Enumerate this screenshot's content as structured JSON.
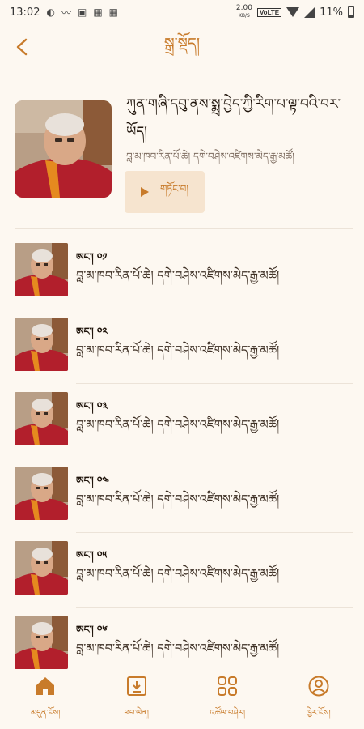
{
  "status_bar": {
    "time": "13:02",
    "net_speed": "2.00",
    "net_unit": "KB/S",
    "volte": "VoLTE",
    "battery": "11%"
  },
  "header": {
    "title": "སྒྲ་སྡོད།",
    "back_icon": "chevron-left-icon"
  },
  "featured": {
    "title": "ཀུན་གཞི་དབུ་ནས་སྨྲ་བྱེད་ཀྱི་རིག་པ་ལྟ་བའི་བར་ཡོད།",
    "speaker": "བླ་མ་ཁབ་རིན་པོ་ཆེ། དགེ་བཤེས་འཛིགས་མེད་རྒྱ་མཚོ།",
    "play_label": "གཏོང་བ།"
  },
  "episodes": [
    {
      "label": "ཨང་། ༠༡",
      "speaker": "བླ་མ་ཁབ་རིན་པོ་ཆེ། དགེ་བཤེས་འཛིགས་མེད་རྒྱ་མཚོ།"
    },
    {
      "label": "ཨང་། ༠༢",
      "speaker": "བླ་མ་ཁབ་རིན་པོ་ཆེ། དགེ་བཤེས་འཛིགས་མེད་རྒྱ་མཚོ།"
    },
    {
      "label": "ཨང་། ༠༣",
      "speaker": "བླ་མ་ཁབ་རིན་པོ་ཆེ། དགེ་བཤེས་འཛིགས་མེད་རྒྱ་མཚོ།"
    },
    {
      "label": "ཨང་། ༠༤",
      "speaker": "བླ་མ་ཁབ་རིན་པོ་ཆེ། དགེ་བཤེས་འཛིགས་མེད་རྒྱ་མཚོ།"
    },
    {
      "label": "ཨང་། ༠༥",
      "speaker": "བླ་མ་ཁབ་རིན་པོ་ཆེ། དགེ་བཤེས་འཛིགས་མེད་རྒྱ་མཚོ།"
    },
    {
      "label": "ཨང་། ༠༦",
      "speaker": "བླ་མ་ཁབ་རིན་པོ་ཆེ། དགེ་བཤེས་འཛིགས་མེད་རྒྱ་མཚོ།"
    }
  ],
  "bottom_nav": [
    {
      "label": "མདུན་ངོས།",
      "icon": "home-icon",
      "active": true
    },
    {
      "label": "ཕབ་ལེན།",
      "icon": "download-icon",
      "active": false
    },
    {
      "label": "འཚོལ་བཤེར།",
      "icon": "grid-icon",
      "active": false
    },
    {
      "label": "ཁྱེར་ངོས།",
      "icon": "user-icon",
      "active": false
    }
  ],
  "colors": {
    "accent": "#c87b2b",
    "background": "#fdf8f1",
    "play_button_bg": "#f6e4cf"
  }
}
